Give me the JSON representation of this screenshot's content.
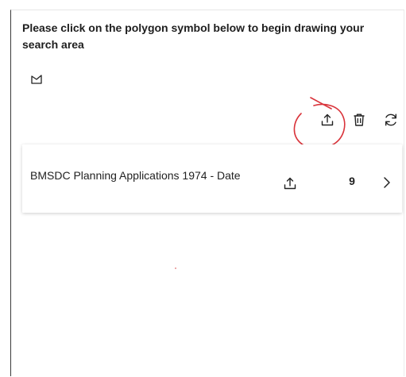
{
  "panel": {
    "instruction": "Please click on the polygon symbol below to begin drawing your search area"
  },
  "tools": {
    "polygon_icon": "polygon-draw-icon"
  },
  "toolbar": {
    "export_icon": "export-icon",
    "delete_icon": "trash-icon",
    "refresh_icon": "refresh-icon"
  },
  "annotation_color": "#d9343b",
  "results": [
    {
      "title": "BMSDC Planning Applications 1974 - Date",
      "count": "9",
      "export_icon": "export-icon",
      "chevron_icon": "chevron-right-icon"
    }
  ]
}
